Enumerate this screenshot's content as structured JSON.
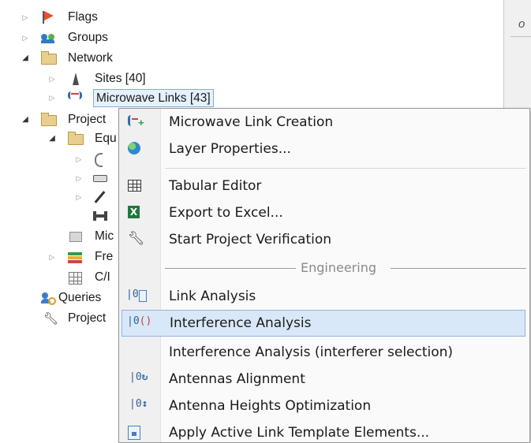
{
  "tree": {
    "items": [
      {
        "label": "Flags",
        "icon": "flag-icon",
        "expander": "collapsed"
      },
      {
        "label": "Groups",
        "icon": "groups-icon",
        "expander": "collapsed"
      },
      {
        "label": "Network",
        "icon": "folder-icon",
        "expander": "expanded"
      },
      {
        "label": "Sites [40]",
        "icon": "site-tower-icon",
        "expander": "collapsed"
      },
      {
        "label": "Microwave Links [43]",
        "icon": "microwave-link-icon",
        "expander": "collapsed",
        "selected": true
      },
      {
        "label": "Project",
        "icon": "folder-icon",
        "expander": "expanded"
      },
      {
        "label": "Equ",
        "icon": "folder-icon",
        "expander": "expanded"
      },
      {
        "label": "",
        "icon": "antenna-icon",
        "expander": "collapsed"
      },
      {
        "label": "",
        "icon": "cable-icon",
        "expander": "collapsed"
      },
      {
        "label": "",
        "icon": "feeder-icon",
        "expander": "collapsed"
      },
      {
        "label": "",
        "icon": "connector-icon",
        "expander": "none"
      },
      {
        "label": "Mic",
        "icon": "equipment-icon",
        "expander": "none"
      },
      {
        "label": "Fre",
        "icon": "frequency-plan-icon",
        "expander": "collapsed"
      },
      {
        "label": "C/I",
        "icon": "grid-table-icon",
        "expander": "none"
      },
      {
        "label": "Queries",
        "icon": "queries-icon",
        "expander": "none"
      },
      {
        "label": "Project",
        "icon": "wrench-icon",
        "expander": "none"
      }
    ]
  },
  "right_panel": {
    "glyph": "o"
  },
  "context_menu": {
    "items": [
      {
        "label": "Microwave Link Creation",
        "icon": "microwave-link-create-icon"
      },
      {
        "label": "Layer Properties...",
        "icon": "globe-icon"
      },
      {
        "separator": true
      },
      {
        "label": "Tabular Editor",
        "icon": "table-icon"
      },
      {
        "label": "Export to Excel...",
        "icon": "excel-icon"
      },
      {
        "label": "Start Project Verification",
        "icon": "wrench-icon"
      },
      {
        "header": "Engineering"
      },
      {
        "label": "Link Analysis",
        "icon": "link-analysis-icon"
      },
      {
        "label": "Interference Analysis",
        "icon": "interference-analysis-icon",
        "highlighted": true
      },
      {
        "label": "Interference Analysis (interferer selection)",
        "icon": ""
      },
      {
        "label": "Antennas Alignment",
        "icon": "antenna-alignment-icon"
      },
      {
        "label": "Antenna Heights Optimization",
        "icon": "antenna-height-icon"
      },
      {
        "label": "Apply Active Link Template Elements...",
        "icon": "template-icon"
      }
    ]
  },
  "colors": {
    "menu_background": "#fafafa",
    "menu_highlight": "#d9e8f8",
    "menu_highlight_border": "#8fb4e3",
    "tree_selection": "#e5f1fb"
  }
}
